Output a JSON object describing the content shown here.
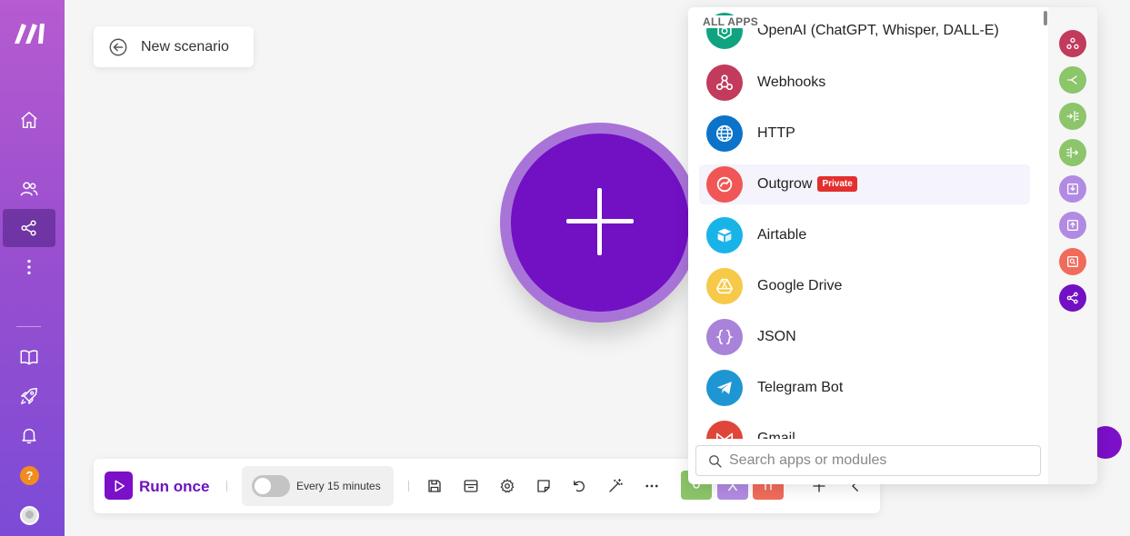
{
  "scenario": {
    "back_label": "New scenario"
  },
  "picker": {
    "header": "ALL APPS",
    "apps": [
      {
        "name": "OpenAI (ChatGPT, Whisper, DALL-E)",
        "color": "#10a37f",
        "icon": "openai-icon"
      },
      {
        "name": "Webhooks",
        "color": "#c23a5c",
        "icon": "webhooks-icon"
      },
      {
        "name": "HTTP",
        "color": "#0b73c9",
        "icon": "globe-icon"
      },
      {
        "name": "Outgrow",
        "badge": "Private",
        "color": "#f05656",
        "icon": "outgrow-icon"
      },
      {
        "name": "Airtable",
        "color": "#18b4e8",
        "icon": "airtable-icon"
      },
      {
        "name": "Google Drive",
        "color": "#f7c948",
        "icon": "google-drive-icon"
      },
      {
        "name": "JSON",
        "color": "#a883d9",
        "icon": "json-icon"
      },
      {
        "name": "Telegram Bot",
        "color": "#1e96d3",
        "icon": "telegram-icon"
      },
      {
        "name": "Gmail",
        "color": "#e0453a",
        "icon": "gmail-icon"
      }
    ],
    "search_placeholder": "Search apps or modules",
    "rail_icons": [
      {
        "name": "webhooks-icon",
        "color": "#c23a5c"
      },
      {
        "name": "router-icon",
        "color": "#8cc56a"
      },
      {
        "name": "aggregator-icon",
        "color": "#8cc56a"
      },
      {
        "name": "iterator-icon",
        "color": "#8cc56a"
      },
      {
        "name": "import-icon",
        "color": "#b18be3"
      },
      {
        "name": "export-icon",
        "color": "#b18be3"
      },
      {
        "name": "search-app-icon",
        "color": "#f16b5a"
      },
      {
        "name": "share-icon",
        "color": "#7210c4"
      }
    ]
  },
  "toolbar": {
    "run_label": "Run once",
    "schedule_label": "Every 15 minutes"
  },
  "colors": {
    "brand": "#7210c4",
    "node_halo": "#a974d8",
    "badge": "#e32f2f"
  }
}
